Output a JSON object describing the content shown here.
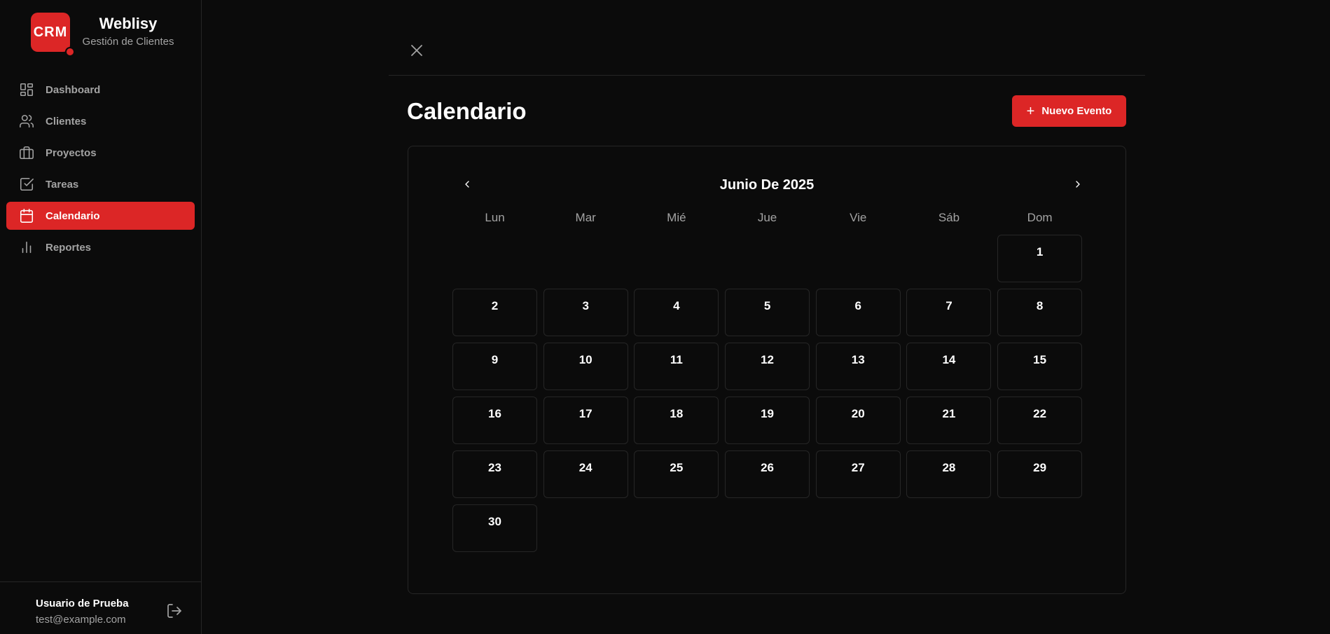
{
  "brand": {
    "logo_text": "CRM",
    "name": "Weblisy",
    "subtitle": "Gestión de Clientes",
    "accent_color": "#dc2626"
  },
  "sidebar": {
    "items": [
      {
        "label": "Dashboard",
        "icon": "dashboard-icon",
        "active": false
      },
      {
        "label": "Clientes",
        "icon": "users-icon",
        "active": false
      },
      {
        "label": "Proyectos",
        "icon": "briefcase-icon",
        "active": false
      },
      {
        "label": "Tareas",
        "icon": "checkbox-icon",
        "active": false
      },
      {
        "label": "Calendario",
        "icon": "calendar-icon",
        "active": true
      },
      {
        "label": "Reportes",
        "icon": "bar-chart-icon",
        "active": false
      }
    ]
  },
  "user": {
    "name": "Usuario de Prueba",
    "email": "test@example.com",
    "logout_icon": "logout-icon"
  },
  "main": {
    "close_icon": "close-icon",
    "title": "Calendario",
    "new_event_label": "Nuevo Evento",
    "new_event_icon": "plus-icon"
  },
  "calendar": {
    "month_label": "Junio De 2025",
    "prev_icon": "chevron-left-icon",
    "next_icon": "chevron-right-icon",
    "weekdays": [
      "Lun",
      "Mar",
      "Mié",
      "Jue",
      "Vie",
      "Sáb",
      "Dom"
    ],
    "leading_blank_days": 6,
    "days": [
      "1",
      "2",
      "3",
      "4",
      "5",
      "6",
      "7",
      "8",
      "9",
      "10",
      "11",
      "12",
      "13",
      "14",
      "15",
      "16",
      "17",
      "18",
      "19",
      "20",
      "21",
      "22",
      "23",
      "24",
      "25",
      "26",
      "27",
      "28",
      "29",
      "30"
    ]
  }
}
